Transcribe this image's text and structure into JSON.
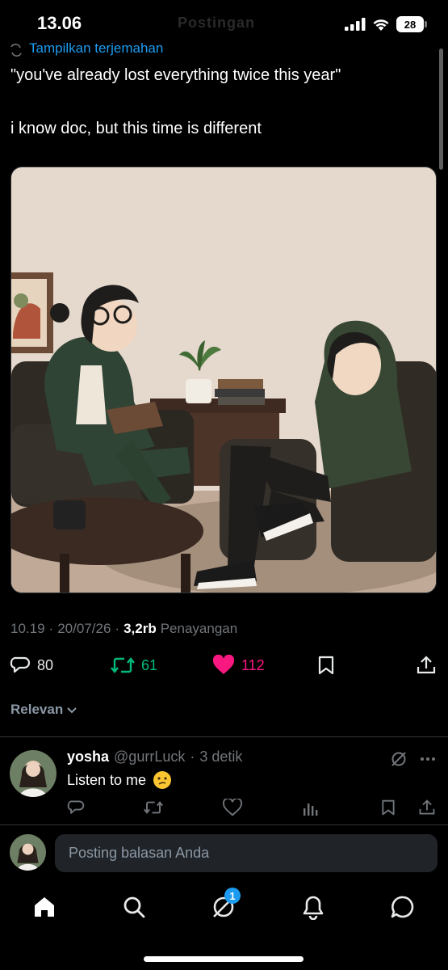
{
  "status_bar": {
    "time": "13.06",
    "ghost_label": "Postingan",
    "battery": "28"
  },
  "tweet": {
    "translate_label": "Tampilkan terjemahan",
    "line1": "\"you've already lost everything twice this year\"",
    "line2": "i know doc, but this time is different",
    "time": "10.19",
    "date": "20/07/26",
    "views_count": "3,2rb",
    "views_label": "Penayangan",
    "replies": "80",
    "retweets": "61",
    "likes": "112"
  },
  "sort_label": "Relevan",
  "reply": {
    "name": "yosha",
    "handle": "@gurrLuck",
    "time": "3 detik",
    "text": "Listen to me"
  },
  "compose": {
    "placeholder": "Posting balasan Anda"
  },
  "nav": {
    "notification_badge": "1"
  },
  "colors": {
    "background": "#000000",
    "link": "#1d9bf0",
    "retweet": "#00ba7c",
    "like": "#f91880",
    "muted": "#71767b"
  },
  "icons": [
    "translate-icon",
    "reply-icon",
    "retweet-icon",
    "heart-icon",
    "bookmark-icon",
    "share-icon",
    "chevron-down-icon",
    "grok-icon",
    "more-icon",
    "views-icon",
    "home-icon",
    "search-icon",
    "grok-nav-icon",
    "bell-icon",
    "messages-icon"
  ]
}
